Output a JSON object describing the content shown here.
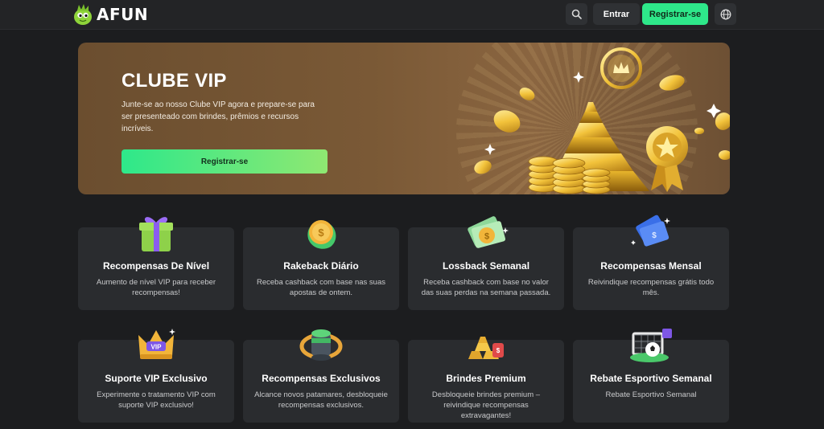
{
  "header": {
    "brand": "AFUN",
    "login_label": "Entrar",
    "register_label": "Registrar-se"
  },
  "banner": {
    "title": "CLUBE VIP",
    "description": "Junte-se ao nosso Clube VIP agora e prepare-se para ser presenteado com brindes, prêmios e recursos incríveis.",
    "button_label": "Registrar-se"
  },
  "colors": {
    "accent": "#2ee88a",
    "card_bg": "#2a2c2f",
    "page_bg": "#1c1d1f"
  },
  "rewards": [
    {
      "icon": "gift-box-icon",
      "title": "Recompensas De Nível",
      "description": "Aumento de nível VIP para receber recompensas!"
    },
    {
      "icon": "coin-bag-icon",
      "title": "Rakeback Diário",
      "description": "Receba cashback com base nas suas apostas de ontem."
    },
    {
      "icon": "cash-bills-icon",
      "title": "Lossback Semanal",
      "description": "Receba cashback com base no valor das suas perdas na semana passada."
    },
    {
      "icon": "money-card-icon",
      "title": "Recompensas Mensal",
      "description": "Reivindique recompensas grátis todo mês."
    },
    {
      "icon": "vip-crown-icon",
      "title": "Suporte VIP Exclusivo",
      "description": "Experimente o tratamento VIP com suporte VIP exclusivo!"
    },
    {
      "icon": "coin-stack-icon",
      "title": "Recompensas Exclusivos",
      "description": "Alcance novos patamares, desbloqueie recompensas exclusivos."
    },
    {
      "icon": "gold-bars-icon",
      "title": "Brindes Premium",
      "description": "Desbloqueie brindes premium – reivindique recompensas extravagantes!"
    },
    {
      "icon": "soccer-goal-icon",
      "title": "Rebate Esportivo Semanal",
      "description": "Rebate Esportivo Semanal"
    }
  ]
}
